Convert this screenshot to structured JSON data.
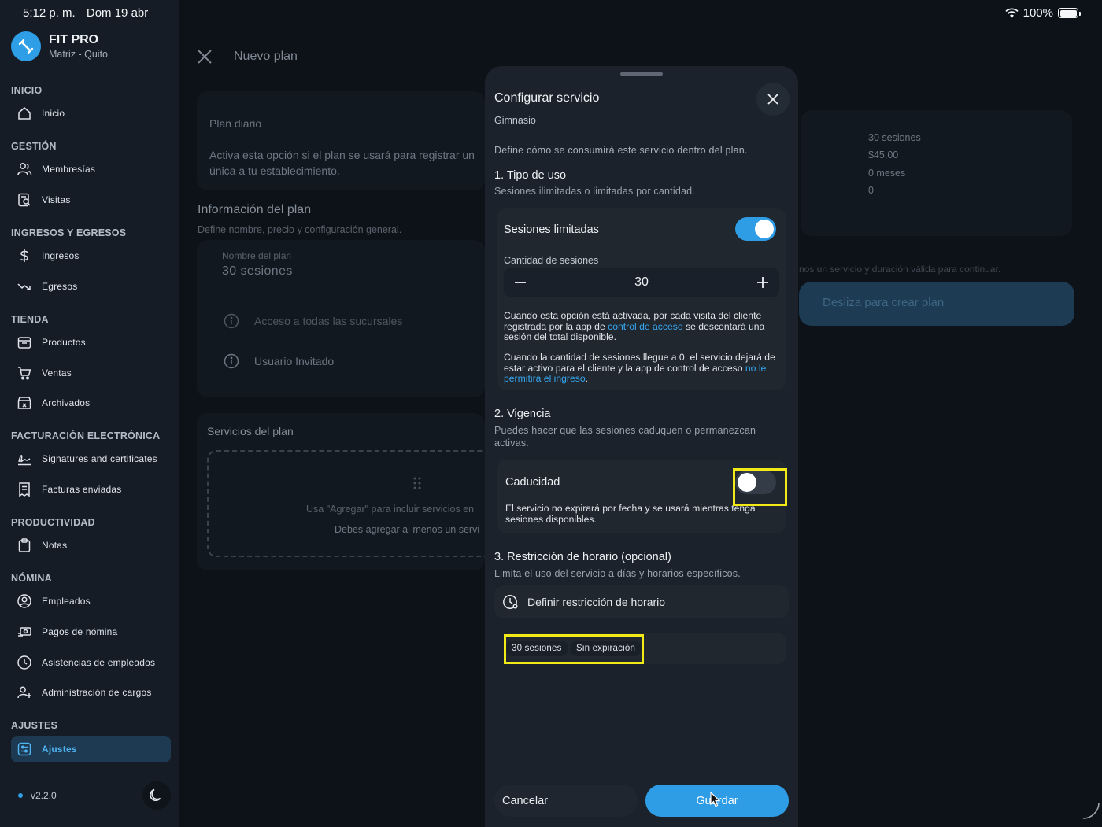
{
  "status_bar": {
    "time": "5:12 p. m.",
    "date": "Dom 19 abr",
    "battery": "100%"
  },
  "brand": {
    "name": "FIT PRO",
    "subtitle": "Matriz - Quito"
  },
  "sidebar": {
    "sections": [
      {
        "title": "INICIO",
        "items": [
          {
            "label": "Inicio",
            "icon": "home-icon"
          }
        ]
      },
      {
        "title": "GESTIÓN",
        "items": [
          {
            "label": "Membresías",
            "icon": "users-icon"
          },
          {
            "label": "Visitas",
            "icon": "visits-icon"
          }
        ]
      },
      {
        "title": "INGRESOS Y EGRESOS",
        "items": [
          {
            "label": "Ingresos",
            "icon": "dollar-icon"
          },
          {
            "label": "Egresos",
            "icon": "trend-down-icon"
          }
        ]
      },
      {
        "title": "TIENDA",
        "items": [
          {
            "label": "Productos",
            "icon": "box-icon"
          },
          {
            "label": "Ventas",
            "icon": "cart-icon"
          },
          {
            "label": "Archivados",
            "icon": "archive-icon"
          }
        ]
      },
      {
        "title": "FACTURACIÓN ELECTRÓNICA",
        "items": [
          {
            "label": "Signatures and certificates",
            "icon": "signature-icon"
          },
          {
            "label": "Facturas enviadas",
            "icon": "receipt-icon"
          }
        ]
      },
      {
        "title": "PRODUCTIVIDAD",
        "items": [
          {
            "label": "Notas",
            "icon": "clipboard-icon"
          }
        ]
      },
      {
        "title": "NÓMINA",
        "items": [
          {
            "label": "Empleados",
            "icon": "user-circle-icon"
          },
          {
            "label": "Pagos de nómina",
            "icon": "payment-icon"
          },
          {
            "label": "Asistencias de empleados",
            "icon": "clock-icon"
          },
          {
            "label": "Administración de cargos",
            "icon": "user-add-icon"
          }
        ]
      },
      {
        "title": "AJUSTES",
        "items": [
          {
            "label": "Ajustes",
            "icon": "settings-icon",
            "active": true
          }
        ]
      }
    ],
    "version": "v2.2.0"
  },
  "page": {
    "title": "Nuevo plan",
    "daily_plan": {
      "title": "Plan diario",
      "description_line1": "Activa esta opción si el plan se usará para registrar un",
      "description_line2": "única a tu establecimiento."
    },
    "info": {
      "title": "Información del plan",
      "subtitle": "Define nombre, precio y configuración general."
    },
    "name_field": {
      "label": "Nombre del plan",
      "value": "30 sesiones"
    },
    "access_all": "Acceso a todas las sucursales",
    "guest_user": "Usuario Invitado",
    "services": {
      "title": "Servicios del plan",
      "hint": "Usa \"Agregar\" para incluir servicios en",
      "warning": "Debes agregar al menos un servi"
    },
    "summary": {
      "sessions": "30 sesiones",
      "price": "$45,00",
      "duration": "0 meses",
      "count": "0"
    },
    "validation_note": "nos un servicio y duración válida para continuar.",
    "slide_button": "Desliza para crear plan"
  },
  "modal": {
    "title": "Configurar servicio",
    "service_name": "Gimnasio",
    "description": "Define cómo se consumirá este servicio dentro del plan.",
    "usage": {
      "title": "1. Tipo de uso",
      "subtitle": "Sesiones ilimitadas o limitadas por cantidad.",
      "limited_label": "Sesiones limitadas",
      "limited_on": true,
      "quantity_label": "Cantidad de sesiones",
      "quantity": "30",
      "help1_a": "Cuando esta opción está activada, por cada visita del cliente registrada por la app de ",
      "help1_link": "control de acceso",
      "help1_b": " se descontará una sesión del total disponible.",
      "help2_a": "Cuando la cantidad de sesiones llegue a 0, el servicio dejará de estar activo para el cliente y la app de control de acceso ",
      "help2_link": "no le permitirá el ingreso",
      "help2_b": "."
    },
    "validity": {
      "title": "2. Vigencia",
      "subtitle": "Puedes hacer que las sesiones caduquen o permanezcan activas.",
      "expiry_label": "Caducidad",
      "expiry_on": false,
      "expiry_help": "El servicio no expirará por fecha y se usará mientras tenga sesiones disponibles."
    },
    "schedule": {
      "title": "3. Restricción de horario (opcional)",
      "subtitle": "Limita el uso del servicio a días y horarios específicos.",
      "button": "Definir restricción de horario"
    },
    "chips": [
      "30 sesiones",
      "Sin expiración"
    ],
    "cancel": "Cancelar",
    "save": "Guardar"
  },
  "colors": {
    "accent": "#2f9ce6",
    "highlight": "#f2ea16",
    "sidebar_bg": "#151c25",
    "modal_bg": "#1b222b"
  }
}
